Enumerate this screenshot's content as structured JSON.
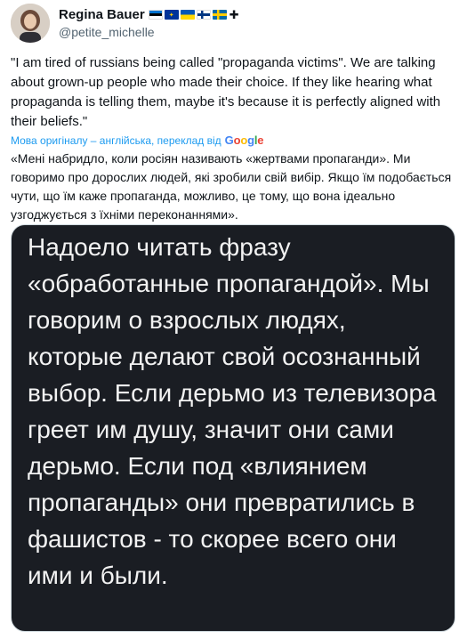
{
  "author": {
    "display_name": "Regina Bauer",
    "handle": "@petite_michelle",
    "flags": [
      "estonia-flag",
      "eu-flag",
      "ukraine-flag",
      "finland-flag",
      "sweden-flag"
    ],
    "extra_symbol": "✚"
  },
  "tweet": {
    "text": "\"I am tired of russians being called \"propaganda victims\". We are talking about grown-up people who made their choice. If they like hearing what propaganda is telling them, maybe it's because it is perfectly aligned with their beliefs.\""
  },
  "translation": {
    "notice": "Мова оригіналу – англійська, переклад від",
    "provider": "Google",
    "text": "«Мені набридло, коли росіян називають «жертвами пропаганди». Ми говоримо про дорослих людей, які зробили свій вибір. Якщо їм подобається чути, що їм каже пропаганда, можливо, це тому, що вона ідеально узгоджується з їхніми переконаннями»."
  },
  "media": {
    "text": "Надоело читать фразу «обработанные пропагандой». Мы говорим о взрослых людях, которые делают свой осознанный выбор. Если дерьмо из телевизора греет им душу, значит они сами дерьмо. Если под «влиянием пропаганды» они превратились в фашистов - то скорее всего они ими и были."
  },
  "colors": {
    "link_blue": "#1d9bf0",
    "secondary_text": "#536471",
    "media_bg": "#1a1d23"
  }
}
